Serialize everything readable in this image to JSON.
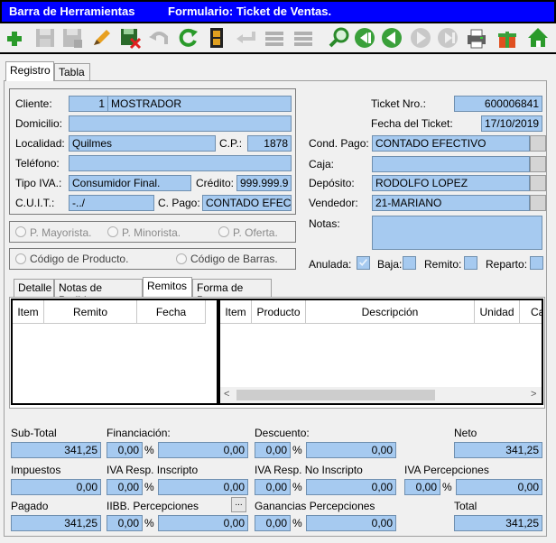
{
  "title": {
    "left": "Barra de Herramientas",
    "right": "Formulario: Ticket de Ventas."
  },
  "toolbar_icons": [
    "add-icon",
    "save-icon",
    "save-disabled-icon",
    "edit-icon",
    "save-cancel-icon",
    "undo-icon",
    "refresh-icon",
    "film-icon",
    "back-arrow-icon",
    "list-icon",
    "list2-icon",
    "search-icon",
    "first-icon",
    "prev-icon",
    "next-icon",
    "last-icon",
    "printer-icon",
    "gift-icon",
    "home-icon"
  ],
  "top_tabs": [
    "Registro",
    "Tabla"
  ],
  "client": {
    "cliente_label": "Cliente:",
    "cliente_num": "1",
    "cliente_name": "MOSTRADOR",
    "domicilio_label": "Domicilio:",
    "domicilio": "",
    "localidad_label": "Localidad:",
    "localidad": "Quilmes",
    "cp_label": "C.P.:",
    "cp": "1878",
    "telefono_label": "Teléfono:",
    "telefono": "",
    "tipo_iva_label": "Tipo IVA.:",
    "tipo_iva": "Consumidor Final.",
    "credito_label": "Crédito:",
    "credito": "999.999.9",
    "cuit_label": "C.U.I.T.:",
    "cuit": "-../",
    "c_pago_label": "C. Pago:",
    "c_pago": "CONTADO EFEC"
  },
  "price_radios": [
    "P. Mayorista.",
    "P. Minorista.",
    "P. Oferta."
  ],
  "code_radios": [
    "Código de Producto.",
    "Código de Barras."
  ],
  "ticket": {
    "nro_label": "Ticket Nro.:",
    "nro": "600006841",
    "fecha_label": "Fecha del Ticket:",
    "fecha": "17/10/2019",
    "cond_pago_label": "Cond. Pago:",
    "cond_pago": "CONTADO EFECTIVO",
    "caja_label": "Caja:",
    "caja": "",
    "deposito_label": "Depósito:",
    "deposito": "RODOLFO LOPEZ",
    "vendedor_label": "Vendedor:",
    "vendedor": "21-MARIANO",
    "notas_label": "Notas:",
    "anulada_label": "Anulada:",
    "baja_label": "Baja:",
    "remito_label": "Remito:",
    "reparto_label": "Reparto:"
  },
  "sub_tabs": [
    "Detalle",
    "Notas de Pedido",
    "Remitos",
    "Forma de Pago"
  ],
  "remitos_columns": [
    "Item",
    "Remito",
    "Fecha"
  ],
  "detail_columns": [
    "Item",
    "Producto",
    "Descripción",
    "Unidad",
    "Ca"
  ],
  "totals": {
    "subtotal_label": "Sub-Total",
    "subtotal": "341,25",
    "financiacion_label": "Financiación:",
    "financiacion_pct": "0,00",
    "financiacion": "0,00",
    "descuento_label": "Descuento:",
    "descuento_pct": "0,00",
    "descuento": "0,00",
    "neto_label": "Neto",
    "neto": "341,25",
    "impuestos_label": "Impuestos",
    "impuestos": "0,00",
    "iva_ri_label": "IVA Resp. Inscripto",
    "iva_ri_pct": "0,00",
    "iva_ri": "0,00",
    "iva_rni_label": "IVA Resp. No Inscripto",
    "iva_rni_pct": "0,00",
    "iva_rni": "0,00",
    "iva_perc_label": "IVA Percepciones",
    "iva_perc_pct": "0,00",
    "iva_perc": "0,00",
    "pagado_label": "Pagado",
    "pagado": "341,25",
    "iibb_label": "IIBB. Percepciones",
    "iibb_btn": "...",
    "iibb_pct": "0,00",
    "iibb": "0,00",
    "ganancias_label": "Ganancias Percepciones",
    "ganancias_pct": "0,00",
    "ganancias": "0,00",
    "total_label": "Total",
    "total": "341,25",
    "pct_sign": "%"
  },
  "scroll": {
    "left": "<",
    "right": ">"
  }
}
